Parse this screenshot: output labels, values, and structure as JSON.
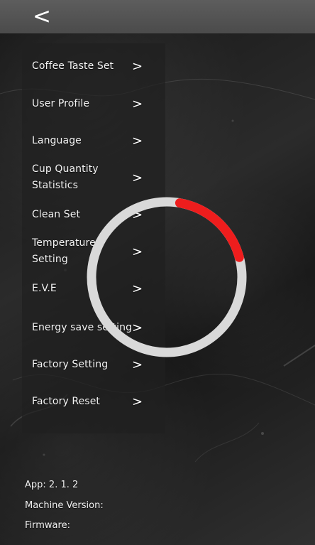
{
  "header": {
    "back_icon": "<"
  },
  "menu": {
    "items": [
      {
        "label": "Coffee Taste Set",
        "arrow": ">"
      },
      {
        "label": "User Profile",
        "arrow": ">"
      },
      {
        "label": "Language",
        "arrow": ">"
      },
      {
        "label": "Cup Quantity Statistics",
        "arrow": ">"
      },
      {
        "label": "Clean Set",
        "arrow": ">"
      },
      {
        "label": "Temperature Setting",
        "arrow": ">"
      },
      {
        "label": "E.V.E",
        "arrow": ">"
      },
      {
        "label": "Energy save setting",
        "arrow": ">"
      },
      {
        "label": "Factory Setting",
        "arrow": ">"
      },
      {
        "label": "Factory Reset",
        "arrow": ">"
      }
    ]
  },
  "loading": {
    "track_color": "#d9d9d9",
    "progress_color": "#ee1d1d",
    "progress_fraction": 0.18
  },
  "footer": {
    "app_label": "App:",
    "app_value": "2. 1. 2",
    "machine_version_label": "Machine Version:",
    "firmware_label": "Firmware:"
  }
}
